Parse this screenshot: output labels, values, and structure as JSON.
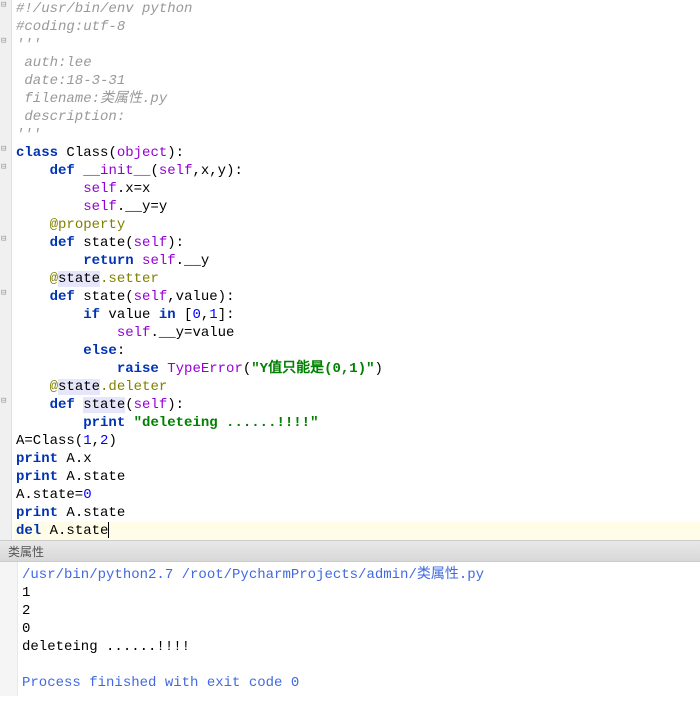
{
  "code": {
    "l1": "#!/usr/bin/env python",
    "l2": "#coding:utf-8",
    "l3": "'''",
    "l4": " auth:lee",
    "l5": " date:18-3-31",
    "l6": " filename:类属性.py",
    "l7": " description:",
    "l8": "'''",
    "l9_class": "class",
    "l9_name": " Class",
    "l9_obj": "object",
    "l10_def": "def",
    "l10_init": "__init__",
    "l10_self": "self",
    "l10_args": ",x,y):",
    "l11_self": "self",
    "l11_rest": ".x=x",
    "l12_self": "self",
    "l12_rest": ".__y=y",
    "l13_dec": "@property",
    "l14_def": "def",
    "l14_name": " state",
    "l14_self": "self",
    "l15_ret": "return",
    "l15_self": "self",
    "l15_rest": ".__y",
    "l16_at": "@",
    "l16_state": "state",
    "l16_setter": ".setter",
    "l17_def": "def",
    "l17_name": " state",
    "l17_self": "self",
    "l17_args": ",value):",
    "l18_if": "if",
    "l18_val": " value ",
    "l18_in": "in",
    "l18_lb": " [",
    "l18_n0": "0",
    "l18_c": ",",
    "l18_n1": "1",
    "l18_rb": "]:",
    "l19_self": "self",
    "l19_rest": ".__y=value",
    "l20_else": "else",
    "l21_raise": "raise",
    "l21_err": "TypeError",
    "l21_str": "\"Y值只能是(0,1)\"",
    "l22_at": "@",
    "l22_state": "state",
    "l22_deleter": ".deleter",
    "l23_def": "def",
    "l23_name": "state",
    "l23_self": "self",
    "l24_print": "print",
    "l24_str": "\"deleteing ......!!!!\"",
    "l25_a": "A=Class(",
    "l25_n1": "1",
    "l25_c": ",",
    "l25_n2": "2",
    "l25_rp": ")",
    "l26_print": "print",
    "l26_rest": " A.x",
    "l27_print": "print",
    "l27_rest": " A.state",
    "l28_a": "A.state=",
    "l28_n": "0",
    "l29_print": "print",
    "l29_rest": " A.state",
    "l30_del": "del",
    "l30_rest": " A.state"
  },
  "tab_name": "类属性",
  "console": {
    "cmd": "/usr/bin/python2.7 /root/PycharmProjects/admin/类属性.py",
    "out1": "1",
    "out2": "2",
    "out3": "0",
    "out4": "deleteing ......!!!!",
    "exit": "Process finished with exit code 0"
  }
}
